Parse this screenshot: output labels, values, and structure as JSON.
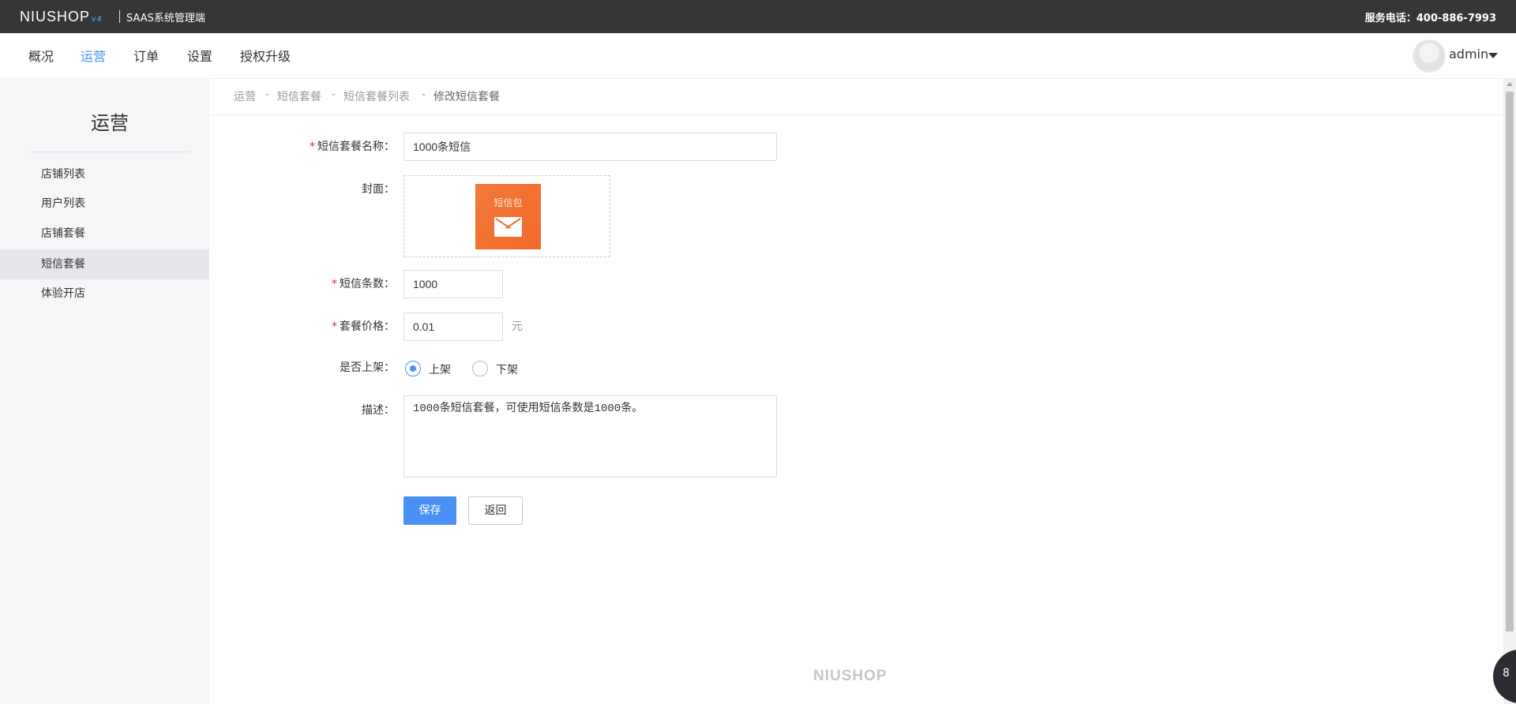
{
  "topbar": {
    "logo": "NIUSHOP",
    "logo_version": "v4",
    "subtitle": "SAAS系统管理端",
    "hotline": "服务电话：400-886-7993"
  },
  "nav": {
    "items": [
      "概况",
      "运营",
      "订单",
      "设置",
      "授权升级"
    ],
    "active_index": 1,
    "user": "admin"
  },
  "sidebar": {
    "title": "运营",
    "items": [
      "店铺列表",
      "用户列表",
      "店铺套餐",
      "短信套餐",
      "体验开店"
    ],
    "active_index": 3
  },
  "breadcrumb": {
    "items": [
      "运营",
      "短信套餐",
      "短信套餐列表",
      "修改短信套餐"
    ],
    "separator": "-"
  },
  "form": {
    "name": {
      "label": "短信套餐名称：",
      "value": "1000条短信",
      "required": true
    },
    "cover": {
      "label": "封面：",
      "image_text": "短信包",
      "icon": "envelope-icon"
    },
    "count": {
      "label": "短信条数：",
      "value": "1000",
      "required": true
    },
    "price": {
      "label": "套餐价格：",
      "value": "0.01",
      "unit": "元",
      "required": true
    },
    "status": {
      "label": "是否上架：",
      "options": [
        "上架",
        "下架"
      ],
      "selected_index": 0
    },
    "desc": {
      "label": "描述：",
      "value": "1000条短信套餐，可使用短信条数是1000条。"
    },
    "save_label": "保存",
    "back_label": "返回"
  },
  "footer": {
    "logo": "NIUSHOP"
  },
  "float_button": {
    "label": "8"
  },
  "colors": {
    "primary": "#4a90f5",
    "topbar": "#363636",
    "required": "#f5222d",
    "cover": "#f2692c"
  }
}
